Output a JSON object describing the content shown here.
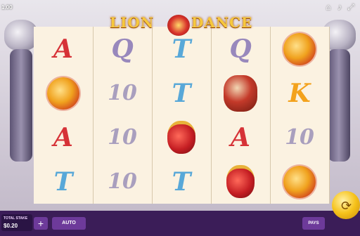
{
  "header": {
    "balance": "1.00",
    "game_title_left": "LION",
    "game_title_right": "DANCE"
  },
  "icons": {
    "home": "home-icon",
    "sound": "speaker-icon",
    "fullscreen": "fullscreen-icon"
  },
  "reels": [
    [
      "A",
      "orb",
      "A",
      "T"
    ],
    [
      "Q",
      "10",
      "10",
      "10"
    ],
    [
      "T",
      "T",
      "lantern",
      "T"
    ],
    [
      "Q",
      "drum",
      "A",
      "lantern"
    ],
    [
      "orb",
      "K",
      "10",
      "orb"
    ]
  ],
  "footer": {
    "stake_label": "TOTAL STAKE",
    "stake_value": "$0.20",
    "plus_label": "+",
    "auto_label": "AUTO",
    "pays_label": "PAYS"
  },
  "colors": {
    "panel": "#3b1d58",
    "buttons": "#6d3a9a",
    "spin": "#f6c21b"
  }
}
